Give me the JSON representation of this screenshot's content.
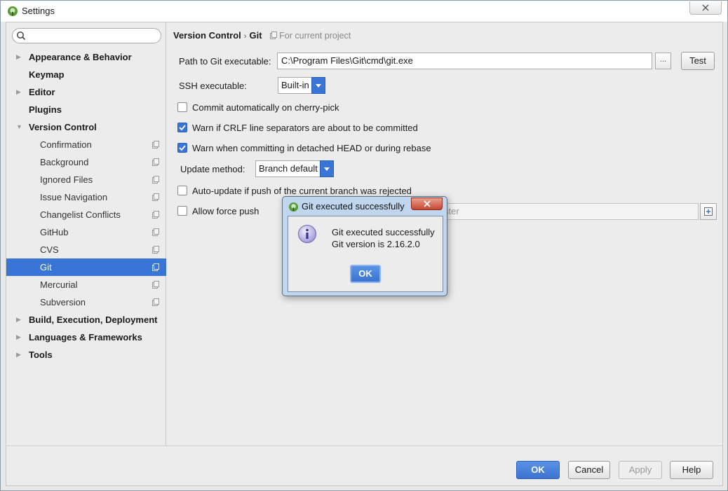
{
  "window": {
    "title": "Settings"
  },
  "search": {
    "placeholder": ""
  },
  "tree": [
    {
      "label": "Appearance & Behavior",
      "level": "top",
      "expandable": true,
      "expanded": false
    },
    {
      "label": "Keymap",
      "level": "top",
      "expandable": false
    },
    {
      "label": "Editor",
      "level": "top",
      "expandable": true,
      "expanded": false
    },
    {
      "label": "Plugins",
      "level": "top",
      "expandable": false
    },
    {
      "label": "Version Control",
      "level": "top",
      "expandable": true,
      "expanded": true
    },
    {
      "label": "Confirmation",
      "level": "child",
      "project_icon": true
    },
    {
      "label": "Background",
      "level": "child",
      "project_icon": true
    },
    {
      "label": "Ignored Files",
      "level": "child",
      "project_icon": true
    },
    {
      "label": "Issue Navigation",
      "level": "child",
      "project_icon": true
    },
    {
      "label": "Changelist Conflicts",
      "level": "child",
      "project_icon": true
    },
    {
      "label": "GitHub",
      "level": "child",
      "project_icon": true
    },
    {
      "label": "CVS",
      "level": "child",
      "project_icon": true
    },
    {
      "label": "Git",
      "level": "child",
      "project_icon": true,
      "selected": true
    },
    {
      "label": "Mercurial",
      "level": "child",
      "project_icon": true
    },
    {
      "label": "Subversion",
      "level": "child",
      "project_icon": true
    },
    {
      "label": "Build, Execution, Deployment",
      "level": "top",
      "expandable": true,
      "expanded": false
    },
    {
      "label": "Languages & Frameworks",
      "level": "top",
      "expandable": true,
      "expanded": false
    },
    {
      "label": "Tools",
      "level": "top",
      "expandable": true,
      "expanded": false
    }
  ],
  "breadcrumb": {
    "parent": "Version Control",
    "current": "Git",
    "scope": "For current project"
  },
  "git": {
    "path_label": "Path to Git executable:",
    "path_value": "C:\\Program Files\\Git\\cmd\\git.exe",
    "browse_label": "...",
    "test_label": "Test",
    "ssh_label": "SSH executable:",
    "ssh_value": "Built-in",
    "cherry_pick_label": "Commit automatically on cherry-pick",
    "crlf_label": "Warn if CRLF line separators are about to be committed",
    "detached_label": "Warn when committing in detached HEAD or during rebase",
    "update_method_label": "Update method:",
    "update_method_value": "Branch default",
    "auto_update_label": "Auto-update if push of the current branch was rejected",
    "force_push_label": "Allow force push",
    "protected_branches_value": "ster"
  },
  "footer": {
    "ok": "OK",
    "cancel": "Cancel",
    "apply": "Apply",
    "help": "Help"
  },
  "dialog": {
    "title": "Git executed successfully",
    "line1": "Git executed successfully",
    "line2": "Git version is 2.16.2.0",
    "ok": "OK"
  },
  "colors": {
    "accent": "#3875d7",
    "window_bg": "#ececec"
  }
}
